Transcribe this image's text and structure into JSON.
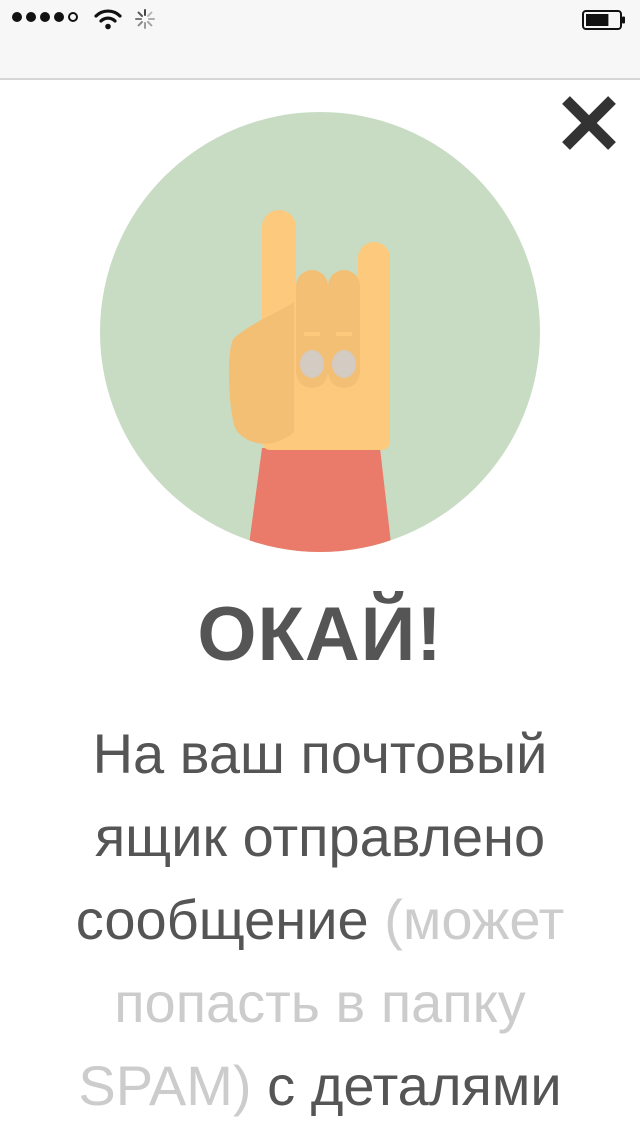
{
  "status_bar": {
    "signal_bars_filled": 4,
    "signal_bars_total": 5,
    "icons": [
      "signal-dots-icon",
      "wifi-icon",
      "loading-spinner-icon",
      "battery-icon"
    ],
    "battery_level": 0.7
  },
  "dialog": {
    "close_icon": "close-x-icon",
    "illustration": "rock-hand-gesture-icon",
    "title": "ОКАЙ!",
    "message": {
      "part1": "На ваш почтовый ящик отправлено сообщение ",
      "note": "(может попасть в папку SPAM)",
      "part2": " с деталями"
    }
  },
  "colors": {
    "circle": "#c8dcc4",
    "hand": "#fcc97d",
    "sleeve": "#ea7b6a",
    "text": "#555555",
    "muted_text": "#cccccc"
  }
}
